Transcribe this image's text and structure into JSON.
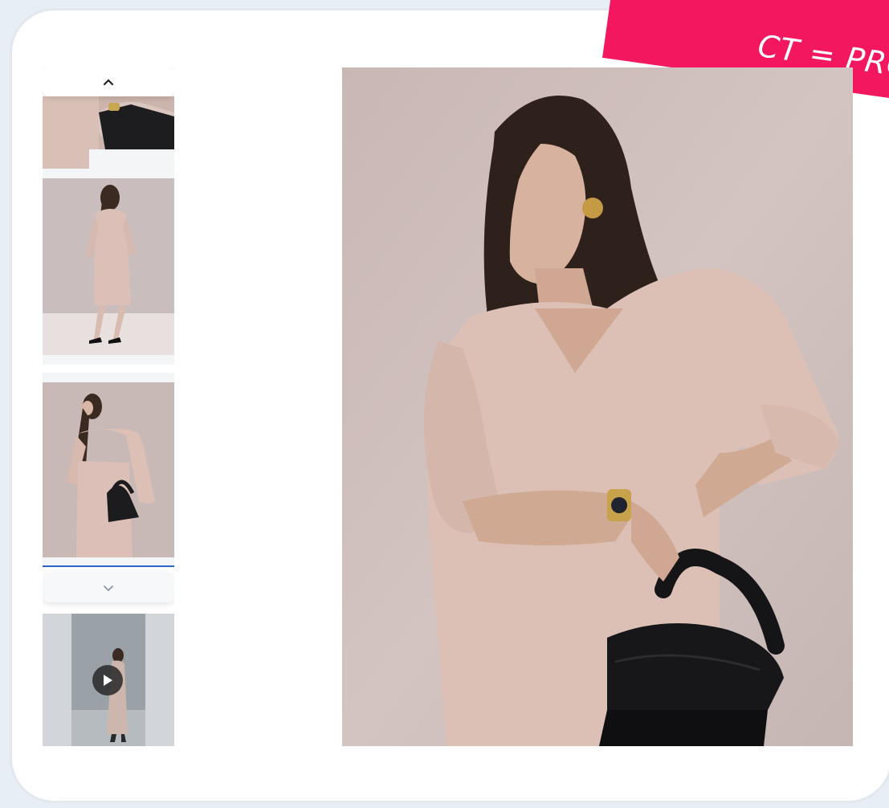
{
  "promo": {
    "label": "CT = PRO"
  },
  "gallery": {
    "scroll_up_icon": "chevron-up-icon",
    "scroll_down_icon": "chevron-down-icon",
    "thumbnails": [
      {
        "name": "thumbnail-detail-bag"
      },
      {
        "name": "thumbnail-back-view"
      },
      {
        "name": "thumbnail-front-view",
        "active": true
      },
      {
        "name": "thumbnail-video",
        "icon": "play-icon"
      }
    ]
  },
  "colors": {
    "accent_banner": "#f2175f",
    "active_indicator": "#2a66c4",
    "dress": "#dcbfb6",
    "wall": "#cec0bd"
  }
}
